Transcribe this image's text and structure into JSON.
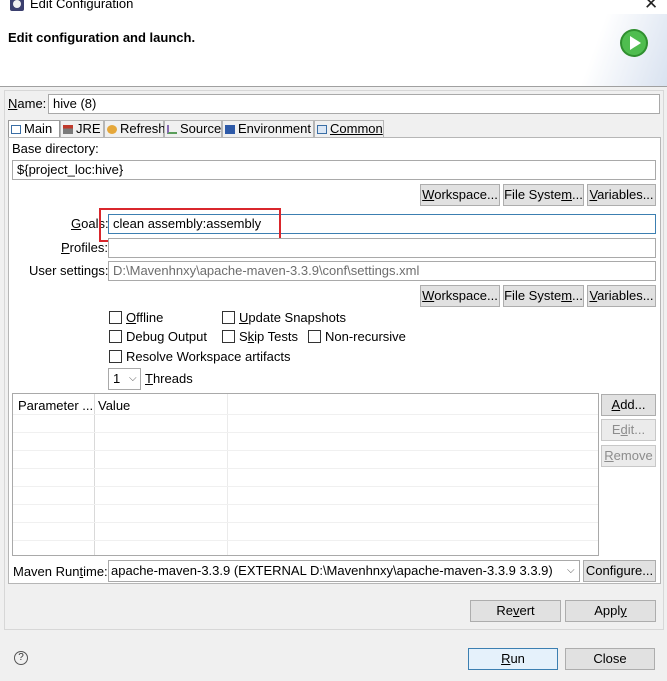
{
  "window": {
    "title": "Edit Configuration",
    "header_title": "Edit configuration and launch."
  },
  "name_field": {
    "label": "Name:",
    "label_mnemonic": "N",
    "label_rest": "ame:",
    "value": "hive (8)"
  },
  "tabs": [
    {
      "label": "Main",
      "icon": "main-tab-icon",
      "active": true
    },
    {
      "label": "JRE",
      "icon": "jre-tab-icon",
      "active": false
    },
    {
      "label": "Refresh",
      "icon": "refresh-tab-icon",
      "active": false
    },
    {
      "label": "Source",
      "icon": "source-tab-icon",
      "active": false
    },
    {
      "label": "Environment",
      "icon": "environment-tab-icon",
      "active": false
    },
    {
      "label": "Common",
      "icon": "common-tab-icon",
      "active": false
    }
  ],
  "main": {
    "base_directory_label": "Base directory:",
    "base_directory_value": "${project_loc:hive}",
    "base_buttons": {
      "workspace_pre": "",
      "workspace_mn": "W",
      "workspace_post": "orkspace...",
      "filesystem_pre": "File Syste",
      "filesystem_mn": "m",
      "filesystem_post": "...",
      "variables_pre": "",
      "variables_mn": "V",
      "variables_post": "ariables..."
    },
    "goals": {
      "label_pre": "",
      "label_mn": "G",
      "label_post": "oals:",
      "value": "clean assembly:assembly"
    },
    "profiles": {
      "label_pre": "",
      "label_mn": "P",
      "label_post": "rofiles:",
      "value": ""
    },
    "user_settings": {
      "label": "User settings:",
      "value": "D:\\Mavenhnxy\\apache-maven-3.3.9\\conf\\settings.xml"
    },
    "settings_buttons": {
      "workspace_pre": "",
      "workspace_mn": "W",
      "workspace_post": "orkspace...",
      "filesystem_pre": "File Syste",
      "filesystem_mn": "m",
      "filesystem_post": "...",
      "variables_pre": "",
      "variables_mn": "V",
      "variables_post": "ariables..."
    },
    "options": {
      "offline": {
        "pre": "",
        "mn": "O",
        "post": "ffline",
        "checked": false
      },
      "update_snapshots": {
        "pre": "",
        "mn": "U",
        "post": "pdate Snapshots",
        "checked": false
      },
      "debug_output": {
        "pre": "Debu",
        "mn": "g",
        "post": " Output",
        "checked": false
      },
      "skip_tests": {
        "pre": "S",
        "mn": "k",
        "post": "ip Tests",
        "checked": false
      },
      "non_recursive": {
        "label": "Non-recursive",
        "checked": false
      },
      "resolve_workspace": {
        "label": "Resolve Workspace artifacts",
        "checked": false
      }
    },
    "threads": {
      "value": "1",
      "label_pre": "",
      "label_mn": "T",
      "label_post": "hreads"
    },
    "parameters_table": {
      "columns": [
        "Parameter ...",
        "Value"
      ],
      "rows": []
    },
    "table_buttons": {
      "add_pre": "",
      "add_mn": "A",
      "add_post": "dd...",
      "edit_pre": "E",
      "edit_mn": "d",
      "edit_post": "it...",
      "remove_pre": "",
      "remove_mn": "R",
      "remove_post": "emove"
    },
    "maven_runtime": {
      "label_pre": "Maven Run",
      "label_mn": "t",
      "label_post": "ime:",
      "value": "apache-maven-3.3.9 (EXTERNAL D:\\Mavenhnxy\\apache-maven-3.3.9 3.3.9)",
      "configure_label": "Configure..."
    }
  },
  "footer_buttons": {
    "revert_pre": "Re",
    "revert_mn": "v",
    "revert_post": "ert",
    "apply_pre": "Appl",
    "apply_mn": "y",
    "apply_post": "",
    "run_pre": "",
    "run_mn": "R",
    "run_post": "un",
    "close_label": "Close",
    "help_symbol": "?"
  },
  "colors": {
    "highlight_box": "#d9262c",
    "focus_border": "#3c7fb1",
    "run_icon": "#3aa83a"
  }
}
